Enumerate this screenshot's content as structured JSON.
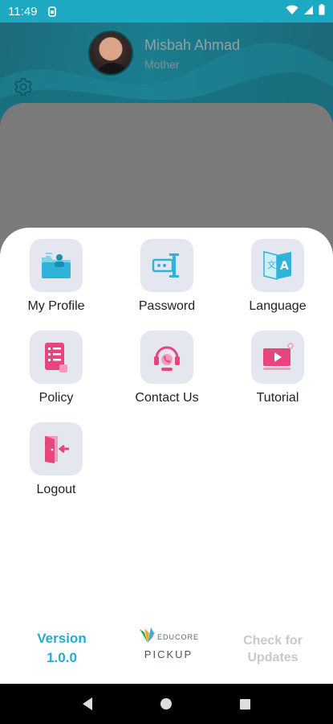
{
  "status_bar": {
    "time": "11:49"
  },
  "profile": {
    "name": "Misbah Ahmad",
    "role": "Mother"
  },
  "menu": [
    {
      "label": "My Profile",
      "icon": "my-profile-icon"
    },
    {
      "label": "Password",
      "icon": "password-icon"
    },
    {
      "label": "Language",
      "icon": "language-icon"
    },
    {
      "label": "Policy",
      "icon": "policy-icon"
    },
    {
      "label": "Contact Us",
      "icon": "contact-us-icon"
    },
    {
      "label": "Tutorial",
      "icon": "tutorial-icon"
    },
    {
      "label": "Logout",
      "icon": "logout-icon"
    }
  ],
  "footer": {
    "version_label": "Version",
    "version_number": "1.0.0",
    "brand_top": "EDUCORE",
    "brand_bottom": "PICKUP",
    "check_updates_line1": "Check for",
    "check_updates_line2": "Updates"
  },
  "colors": {
    "accent": "#27aad0",
    "pink": "#e8447e",
    "blue": "#2fb3d8"
  }
}
